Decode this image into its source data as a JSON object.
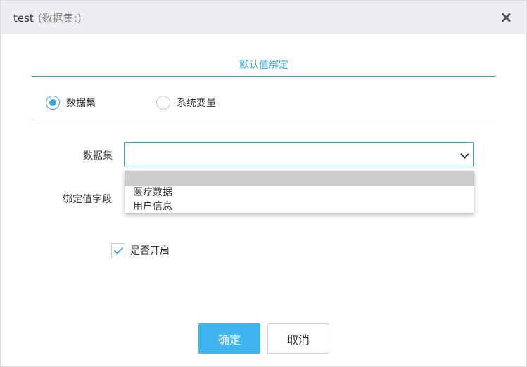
{
  "dialog": {
    "title": "test",
    "subtitle": "(数据集:)"
  },
  "tab": {
    "label": "默认值绑定"
  },
  "source": {
    "options": [
      {
        "label": "数据集",
        "checked": true
      },
      {
        "label": "系统变量",
        "checked": false
      }
    ]
  },
  "form": {
    "dataset_label": "数据集",
    "dataset_value": "",
    "bind_field_label": "绑定值字段"
  },
  "dropdown": {
    "options": [
      "",
      "医疗数据",
      "用户信息"
    ],
    "highlighted_index": 0
  },
  "enable": {
    "label": "是否开启",
    "checked": true
  },
  "buttons": {
    "confirm_label": "确定",
    "cancel_label": "取消"
  },
  "colors": {
    "accent": "#3aa5dc",
    "primary_button": "#3eb5ee",
    "header_bg": "#eceef1"
  }
}
